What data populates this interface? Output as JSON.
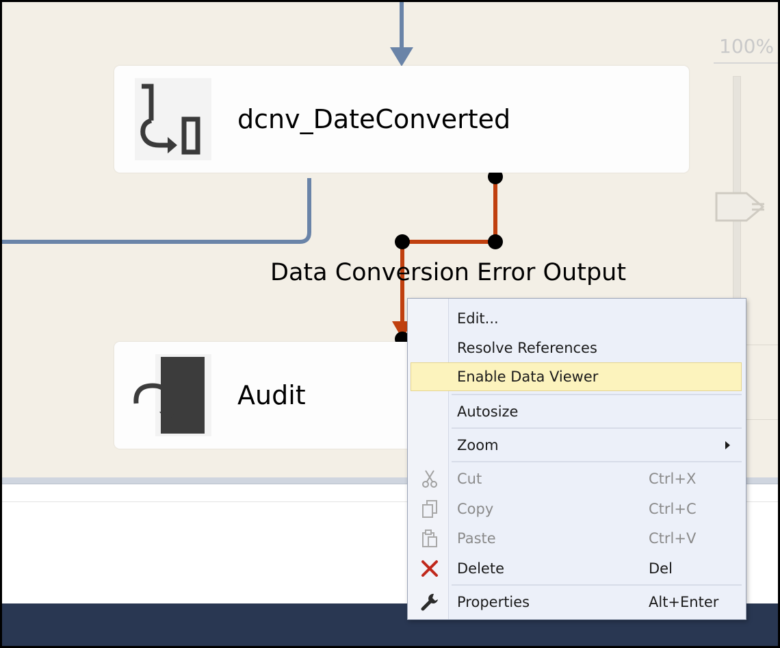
{
  "designer": {
    "tasks": [
      {
        "id": "dcnv",
        "title": "dcnv_DateConverted"
      },
      {
        "id": "audit",
        "title": "Audit"
      }
    ],
    "path_label": "Data Conversion Error Output",
    "zoom": {
      "value": "100%"
    }
  },
  "context_menu": {
    "items": [
      {
        "label": "Edit...",
        "shortcut": ""
      },
      {
        "label": "Resolve References",
        "shortcut": ""
      },
      {
        "label": "Enable Data Viewer",
        "shortcut": "",
        "highlighted": true
      },
      {
        "label": "Autosize",
        "shortcut": ""
      },
      {
        "label": "Zoom",
        "shortcut": "",
        "submenu": true
      },
      {
        "label": "Cut",
        "shortcut": "Ctrl+X",
        "icon": "scissors-icon",
        "disabled": true
      },
      {
        "label": "Copy",
        "shortcut": "Ctrl+C",
        "icon": "copy-icon",
        "disabled": true
      },
      {
        "label": "Paste",
        "shortcut": "Ctrl+V",
        "icon": "paste-icon",
        "disabled": true
      },
      {
        "label": "Delete",
        "shortcut": "Del",
        "icon": "delete-x-icon"
      },
      {
        "label": "Properties",
        "shortcut": "Alt+Enter",
        "icon": "wrench-icon"
      }
    ]
  },
  "colors": {
    "canvas_bg": "#f3efe6",
    "data_path": "#6a84a8",
    "error_path": "#c0400f",
    "menu_highlight": "#fcf3bd",
    "status_bar": "#293752",
    "delete_icon": "#c0281c"
  }
}
